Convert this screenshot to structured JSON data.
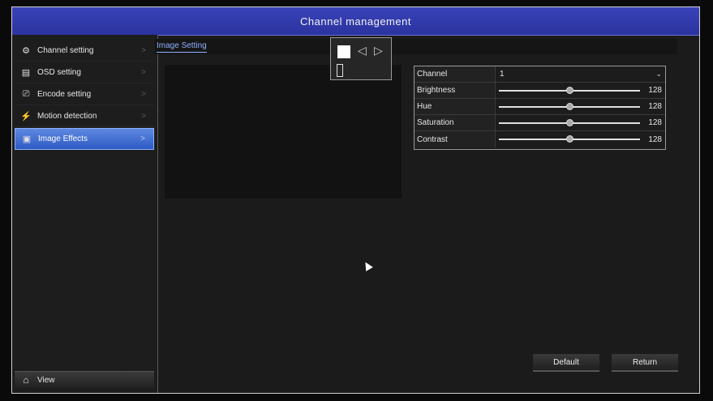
{
  "window": {
    "title": "Channel management"
  },
  "sidebar": {
    "items": [
      {
        "label": "Channel setting",
        "icon": "channel-settings-icon",
        "glyph": "⚙"
      },
      {
        "label": "OSD setting",
        "icon": "osd-icon",
        "glyph": "▤"
      },
      {
        "label": "Encode setting",
        "icon": "encode-icon",
        "glyph": "⎚"
      },
      {
        "label": "Motion detection",
        "icon": "motion-icon",
        "glyph": "⚡"
      },
      {
        "label": "Image Effects",
        "icon": "image-effects-icon",
        "glyph": "▣",
        "active": true
      }
    ],
    "chevron": ">",
    "view": {
      "label": "View",
      "glyph": "⌂"
    }
  },
  "main": {
    "tab": "Image Setting",
    "popup": {
      "left_arrow": "◁",
      "right_arrow": "▷"
    },
    "settings": {
      "channel": {
        "label": "Channel",
        "value": "1",
        "caret": "⌄"
      },
      "sliders": [
        {
          "label": "Brightness",
          "value": 128,
          "max": 255
        },
        {
          "label": "Hue",
          "value": 128,
          "max": 255
        },
        {
          "label": "Saturation",
          "value": 128,
          "max": 255
        },
        {
          "label": "Contrast",
          "value": 128,
          "max": 255
        }
      ]
    },
    "buttons": {
      "default": "Default",
      "return": "Return"
    }
  },
  "colors": {
    "title_bar": "#2f38a8",
    "accent": "#4a78d8",
    "tab_text": "#8fb1ff"
  }
}
